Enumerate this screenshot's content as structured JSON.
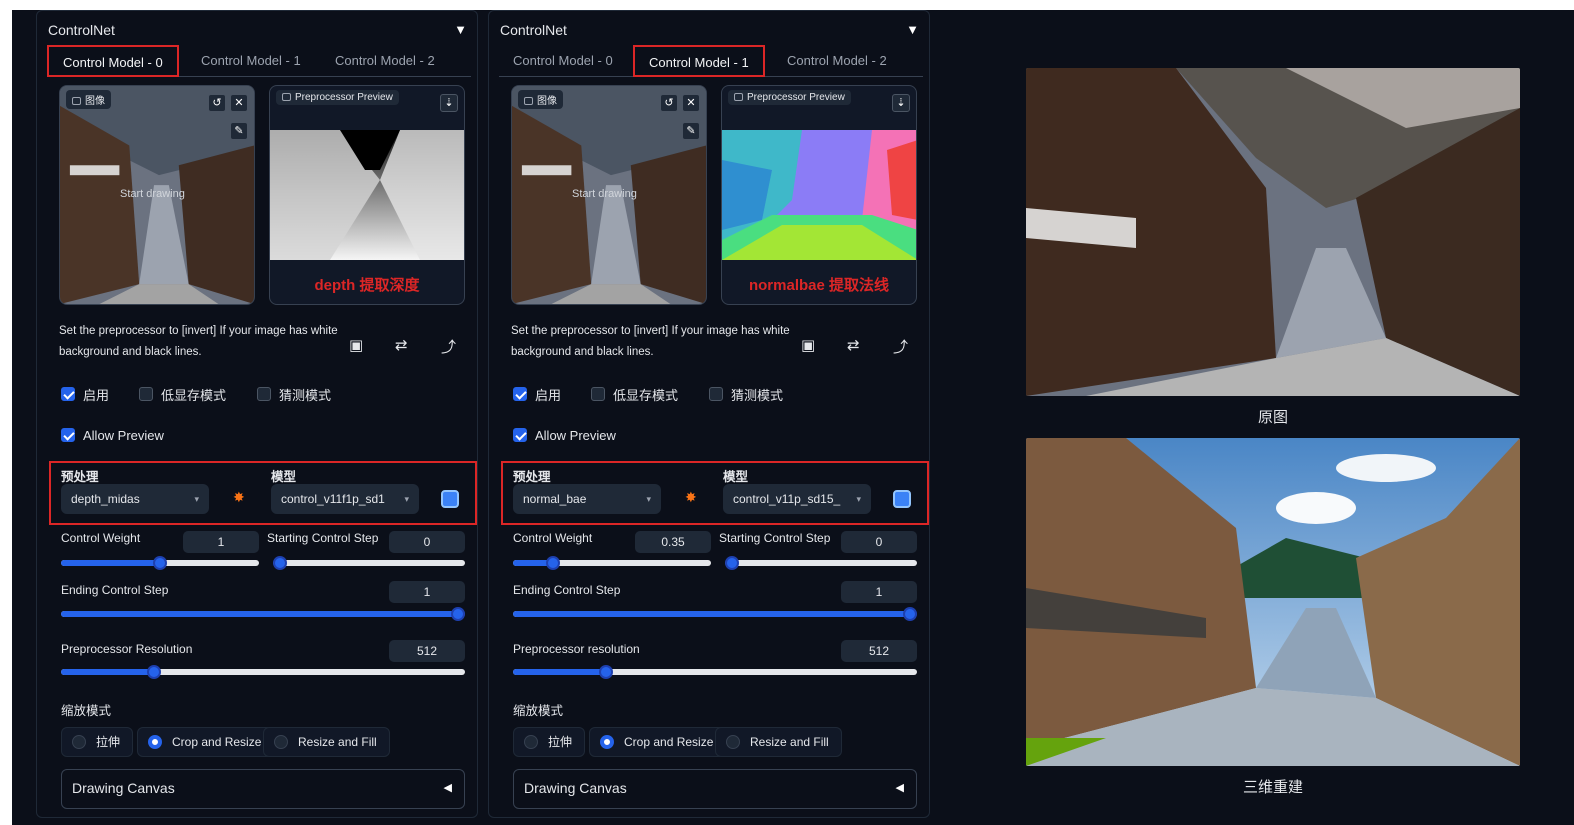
{
  "panels": [
    {
      "title": "ControlNet",
      "tabs": [
        "Control Model - 0",
        "Control Model - 1",
        "Control Model - 2"
      ],
      "active_tab": 0,
      "image_label": "图像",
      "start_drawing": "Start drawing",
      "preview_label": "Preprocessor Preview",
      "preview_caption": "depth 提取深度",
      "note": "Set the preprocessor to [invert] If your image has white background and black lines.",
      "checkboxes": [
        {
          "label": "启用",
          "checked": true
        },
        {
          "label": "低显存模式",
          "checked": false
        },
        {
          "label": "猜测模式",
          "checked": false
        }
      ],
      "allow_preview": {
        "label": "Allow Preview",
        "checked": true
      },
      "preprocessor_label": "预处理",
      "preprocessor_value": "depth_midas",
      "model_label": "模型",
      "model_value": "control_v11f1p_sd1",
      "control_weight": {
        "label": "Control Weight",
        "value": "1",
        "fraction": 0.5
      },
      "starting_step": {
        "label": "Starting Control Step",
        "value": "0",
        "fraction": 0
      },
      "ending_step": {
        "label": "Ending Control Step",
        "value": "1",
        "fraction": 1
      },
      "resolution": {
        "label": "Preprocessor Resolution",
        "value": "512",
        "fraction": 0.23
      },
      "resize_label": "缩放模式",
      "resize_options": [
        "拉伸",
        "Crop and Resize",
        "Resize and Fill"
      ],
      "resize_selected": 1,
      "drawing_canvas": "Drawing Canvas"
    },
    {
      "title": "ControlNet",
      "tabs": [
        "Control Model - 0",
        "Control Model - 1",
        "Control Model - 2"
      ],
      "active_tab": 1,
      "image_label": "图像",
      "start_drawing": "Start drawing",
      "preview_label": "Preprocessor Preview",
      "preview_caption": "normalbae 提取法线",
      "note": "Set the preprocessor to [invert] If your image has white background and black lines.",
      "checkboxes": [
        {
          "label": "启用",
          "checked": true
        },
        {
          "label": "低显存模式",
          "checked": false
        },
        {
          "label": "猜测模式",
          "checked": false
        }
      ],
      "allow_preview": {
        "label": "Allow Preview",
        "checked": true
      },
      "preprocessor_label": "预处理",
      "preprocessor_value": "normal_bae",
      "model_label": "模型",
      "model_value": "control_v11p_sd15_",
      "control_weight": {
        "label": "Control Weight",
        "value": "0.35",
        "fraction": 0.2
      },
      "starting_step": {
        "label": "Starting Control Step",
        "value": "0",
        "fraction": 0
      },
      "ending_step": {
        "label": "Ending Control Step",
        "value": "1",
        "fraction": 1
      },
      "resolution": {
        "label": "Preprocessor resolution",
        "value": "512",
        "fraction": 0.23
      },
      "resize_label": "缩放模式",
      "resize_options": [
        "拉伸",
        "Crop and Resize",
        "Resize and Fill"
      ],
      "resize_selected": 1,
      "drawing_canvas": "Drawing Canvas"
    }
  ],
  "right": {
    "original_caption": "原图",
    "result_caption": "三维重建"
  },
  "colors": {
    "accent": "#2563eb",
    "highlight": "#dc2626",
    "bg": "#0b0f19"
  }
}
